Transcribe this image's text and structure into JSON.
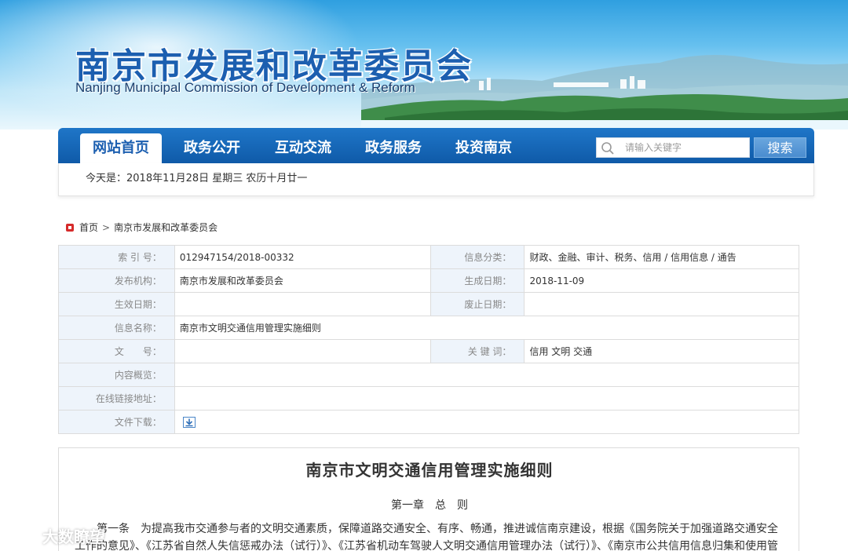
{
  "header": {
    "title": "南京市发展和改革委员会",
    "subtitle": "Nanjing Municipal Commission of Development & Reform"
  },
  "nav": {
    "items": [
      {
        "label": "网站首页",
        "active": true
      },
      {
        "label": "政务公开",
        "active": false
      },
      {
        "label": "互动交流",
        "active": false
      },
      {
        "label": "政务服务",
        "active": false
      },
      {
        "label": "投资南京",
        "active": false
      }
    ],
    "search_placeholder": "请输入关键字",
    "search_button": "搜索"
  },
  "date_bar": {
    "text": "今天是：2018年11月28日  星期三    农历十月廿一"
  },
  "breadcrumb": {
    "home": "首页",
    "separator": ">",
    "current": "南京市发展和改革委员会"
  },
  "info": {
    "index_label": "索 引 号：",
    "index_value": "012947154/2018-00332",
    "category_label": "信息分类：",
    "category_value": "财政、金融、审计、税务、信用 / 信用信息 / 通告",
    "publisher_label": "发布机构：",
    "publisher_value": "南京市发展和改革委员会",
    "created_label": "生成日期：",
    "created_value": "2018-11-09",
    "effective_label": "生效日期：",
    "effective_value": "",
    "abolish_label": "废止日期：",
    "abolish_value": "",
    "name_label": "信息名称：",
    "name_value": "南京市文明交通信用管理实施细则",
    "docno_label": "文　　号：",
    "docno_value": "",
    "keywords_label": "关 键 词：",
    "keywords_value": "信用  文明  交通",
    "overview_label": "内容概览：",
    "overview_value": "",
    "link_label": "在线链接地址：",
    "link_value": "",
    "download_label": "文件下载：",
    "download_icon": "download-icon"
  },
  "article": {
    "title": "南京市文明交通信用管理实施细则",
    "chapter": "第一章　总　则",
    "paragraph": "第一条　为提高我市交通参与者的文明交通素质，保障道路交通安全、有序、畅通，推进诚信南京建设，根据《国务院关于加强道路交通安全工作的意见》、《江苏省自然人失信惩戒办法（试行）》、《江苏省机动车驾驶人文明交通信用管理办法（试行）》、《南京市公共信用信息归集和使用管理暂"
  },
  "watermark": {
    "text": "大数瞭望"
  },
  "colors": {
    "nav_blue": "#1369bd",
    "label_bg": "#eef4fb",
    "title_blue": "#1c5fb0",
    "breadcrumb_icon": "#d62b2b"
  }
}
